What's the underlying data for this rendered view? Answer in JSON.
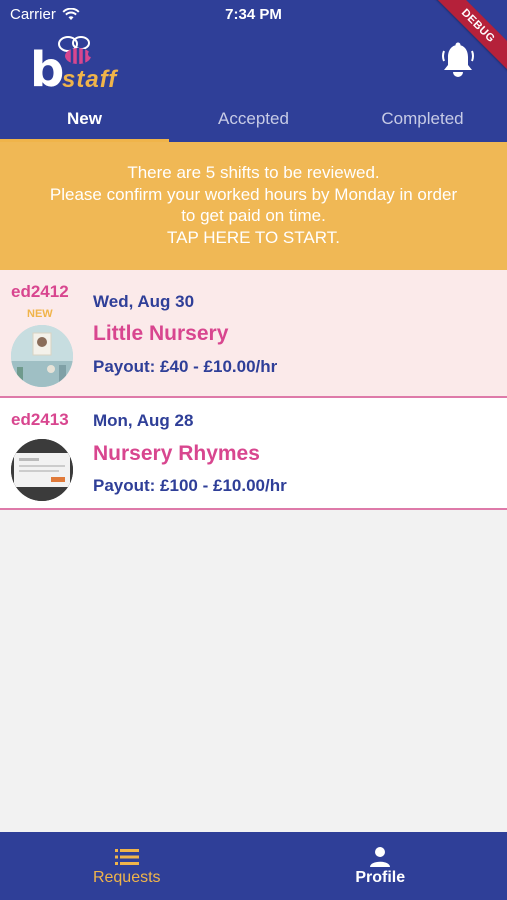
{
  "status_bar": {
    "carrier": "Carrier",
    "time": "7:34 PM"
  },
  "debug_ribbon": "DEBUG",
  "logo": {
    "letter": "b",
    "text": "staff"
  },
  "tabs": [
    {
      "label": "New",
      "active": true
    },
    {
      "label": "Accepted",
      "active": false
    },
    {
      "label": "Completed",
      "active": false
    }
  ],
  "banner": {
    "line1": "There are 5 shifts to be reviewed.",
    "line2": "Please confirm your worked hours by Monday in order",
    "line3": "to get paid on time.",
    "line4": "TAP HERE TO START."
  },
  "shifts": [
    {
      "code": "ed2412",
      "tag": "NEW",
      "date": "Wed, Aug 30",
      "title": "Little Nursery",
      "payout": "Payout: £40 - £10.00/hr"
    },
    {
      "code": "ed2413",
      "tag": "",
      "date": "Mon, Aug 28",
      "title": "Nursery Rhymes",
      "payout": "Payout: £100 - £10.00/hr"
    }
  ],
  "bottom_nav": [
    {
      "label": "Requests",
      "icon": "list-icon",
      "active": true
    },
    {
      "label": "Profile",
      "icon": "person-icon",
      "active": false
    }
  ],
  "colors": {
    "primary": "#2f3f98",
    "accent": "#f0b44a",
    "pink": "#d8468f",
    "banner": "#f0b855",
    "new_row": "#fbeaea"
  }
}
